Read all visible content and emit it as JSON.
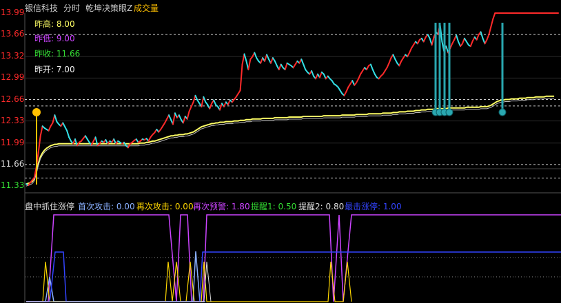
{
  "header": {
    "stock_name": "银信科技",
    "mode": "分时",
    "indicator": "乾坤决策眼Z",
    "volume_tab": "成交量"
  },
  "colors": {
    "up": "#ff2a2a",
    "down": "#33e0e6",
    "avg": "#ffff66",
    "gold": "#ffc000",
    "limit_marker": "#2aa7b0",
    "first_attack": "#8ab0ff",
    "second_attack": "#ffd700",
    "second_warning": "#cc44ff",
    "remind1": "#33dd33",
    "remind2": "#dddddd",
    "break_limit": "#3344ff"
  },
  "info": {
    "prev_high": "昨高: 8.00",
    "prev_low": "昨低: 9.00",
    "prev_close": "昨收: 11.66",
    "prev_open": "昨开: 7.00"
  },
  "indicator_panel": {
    "title": "盘中抓住涨停",
    "first_attack": "首次攻击: 0.00",
    "second_attack": "再次攻击: 0.00",
    "second_warning": "再次预警: 1.80",
    "remind1": "提醒1: 0.50",
    "remind2": "提醒2: 0.80",
    "break_limit": "最击涨停: 1.00"
  },
  "chart_data": {
    "type": "line",
    "ylim": [
      11.33,
      13.99
    ],
    "y_ticks": [
      "13.99",
      "13.66",
      "13.32",
      "12.99",
      "12.66",
      "12.33",
      "11.99",
      "11.66",
      "11.33"
    ],
    "series": [
      {
        "values": [
          11.36,
          11.34,
          11.38,
          11.42,
          11.46,
          11.62,
          11.85,
          12.1,
          12.25,
          12.22,
          12.2,
          12.18,
          12.25,
          12.3,
          12.42,
          12.32,
          12.28,
          12.25,
          12.3,
          12.24,
          12.18,
          12.08,
          12.02,
          11.98,
          12.05,
          11.95,
          12.0,
          12.02,
          12.06,
          12.1,
          12.05,
          12.0,
          11.96,
          12.02,
          12.08,
          11.95,
          11.98,
          12.02,
          12.0,
          12.04,
          11.98,
          12.02,
          12.0,
          12.05,
          11.98,
          12.02,
          12.0,
          11.98,
          12.0,
          11.95,
          11.92,
          11.98,
          12.0,
          12.03,
          12.05,
          12.0,
          12.02,
          12.05,
          12.04,
          12.06,
          12.02,
          12.08,
          12.12,
          12.15,
          12.2,
          12.16,
          12.2,
          12.25,
          12.3,
          12.36,
          12.42,
          12.35,
          12.28,
          12.45,
          12.38,
          12.42,
          12.35,
          12.3,
          12.4,
          12.36,
          12.48,
          12.55,
          12.62,
          12.72,
          12.65,
          12.6,
          12.55,
          12.7,
          12.62,
          12.58,
          12.52,
          12.6,
          12.65,
          12.58,
          12.55,
          12.5,
          12.6,
          12.55,
          12.62,
          12.58,
          12.65,
          12.62,
          12.66,
          12.7,
          12.75,
          12.8,
          13.2,
          13.36,
          13.25,
          13.12,
          13.28,
          13.32,
          13.38,
          13.3,
          13.25,
          13.22,
          13.3,
          13.25,
          13.35,
          13.28,
          13.22,
          13.3,
          13.25,
          13.18,
          13.12,
          13.2,
          13.15,
          13.12,
          13.22,
          13.2,
          13.18,
          13.15,
          13.2,
          13.25,
          13.22,
          13.28,
          13.2,
          13.12,
          13.08,
          13.05,
          13.1,
          13.02,
          12.98,
          13.05,
          13.0,
          13.08,
          13.05,
          12.98,
          13.02,
          12.98,
          12.95,
          12.9,
          12.88,
          12.85,
          12.8,
          12.75,
          12.72,
          12.78,
          12.85,
          12.9,
          12.95,
          12.88,
          12.92,
          12.98,
          13.05,
          13.1,
          13.15,
          13.12,
          13.18,
          13.2,
          13.12,
          13.05,
          13.0,
          12.98,
          13.02,
          13.05,
          13.1,
          13.15,
          13.22,
          13.3,
          13.35,
          13.28,
          13.22,
          13.18,
          13.25,
          13.3,
          13.35,
          13.32,
          13.38,
          13.45,
          13.5,
          13.55,
          13.52,
          13.58,
          13.6,
          13.55,
          13.62,
          13.66,
          13.6,
          13.5,
          13.62,
          13.7,
          13.66,
          13.82,
          13.55,
          13.4,
          13.48,
          13.38,
          13.45,
          13.52,
          13.58,
          13.65,
          13.55,
          13.48,
          13.52,
          13.6,
          13.55,
          13.5,
          13.48,
          13.56,
          13.62,
          13.58,
          13.66,
          13.7,
          13.6,
          13.52,
          13.58,
          13.66,
          13.78,
          13.9,
          13.99,
          13.99,
          13.99,
          13.99,
          13.99,
          13.99,
          13.99,
          13.99,
          13.99,
          13.99,
          13.99,
          13.99,
          13.99,
          13.99,
          13.99,
          13.99,
          13.99,
          13.99,
          13.99,
          13.99,
          13.99,
          13.99,
          13.99,
          13.99,
          13.99,
          13.99,
          13.99,
          13.99,
          13.99,
          13.99,
          13.99,
          13.99
        ]
      },
      {
        "values": [
          11.36,
          11.37,
          11.38,
          11.4,
          11.44,
          11.55,
          11.68,
          11.78,
          11.84,
          11.88,
          11.91,
          11.93,
          11.95,
          11.96,
          11.97,
          11.97,
          11.98,
          11.98,
          11.98,
          11.98,
          11.98,
          11.98,
          11.98,
          11.98,
          11.98,
          11.98,
          11.98,
          11.98,
          11.98,
          11.98,
          11.98,
          11.98,
          11.98,
          11.98,
          11.98,
          11.98,
          11.98,
          11.98,
          11.98,
          11.98,
          11.98,
          11.98,
          11.98,
          11.98,
          11.98,
          11.98,
          11.98,
          11.98,
          11.98,
          11.98,
          11.98,
          11.98,
          11.98,
          11.98,
          11.98,
          11.98,
          11.99,
          11.99,
          11.99,
          12.0,
          12.0,
          12.01,
          12.02,
          12.02,
          12.03,
          12.04,
          12.05,
          12.06,
          12.07,
          12.08,
          12.09,
          12.1,
          12.1,
          12.11,
          12.11,
          12.12,
          12.12,
          12.12,
          12.13,
          12.13,
          12.14,
          12.15,
          12.16,
          12.18,
          12.2,
          12.22,
          12.24,
          12.25,
          12.26,
          12.27,
          12.28,
          12.29,
          12.29,
          12.3,
          12.3,
          12.31,
          12.31,
          12.31,
          12.32,
          12.32,
          12.32,
          12.32,
          12.33,
          12.33,
          12.33,
          12.34,
          12.34,
          12.34,
          12.35,
          12.35,
          12.35,
          12.36,
          12.36,
          12.36,
          12.36,
          12.36,
          12.37,
          12.37,
          12.37,
          12.37,
          12.37,
          12.37,
          12.38,
          12.38,
          12.38,
          12.38,
          12.38,
          12.38,
          12.38,
          12.39,
          12.39,
          12.39,
          12.39,
          12.39,
          12.39,
          12.39,
          12.4,
          12.4,
          12.4,
          12.4,
          12.4,
          12.4,
          12.4,
          12.4,
          12.4,
          12.4,
          12.41,
          12.41,
          12.41,
          12.41,
          12.41,
          12.41,
          12.41,
          12.41,
          12.41,
          12.42,
          12.42,
          12.42,
          12.42,
          12.42,
          12.42,
          12.42,
          12.43,
          12.43,
          12.43,
          12.43,
          12.43,
          12.43,
          12.44,
          12.44,
          12.44,
          12.44,
          12.44,
          12.44,
          12.44,
          12.45,
          12.45,
          12.45,
          12.45,
          12.45,
          12.46,
          12.46,
          12.46,
          12.47,
          12.47,
          12.47,
          12.47,
          12.48,
          12.48,
          12.48,
          12.48,
          12.49,
          12.49,
          12.49,
          12.5,
          12.5,
          12.5,
          12.51,
          12.51,
          12.51,
          12.51,
          12.52,
          12.52,
          12.52,
          12.52,
          12.52,
          12.52,
          12.53,
          12.53,
          12.53,
          12.53,
          12.53,
          12.53,
          12.53,
          12.53,
          12.53,
          12.54,
          12.54,
          12.54,
          12.54,
          12.54,
          12.54,
          12.54,
          12.55,
          12.55,
          12.55,
          12.55,
          12.56,
          12.57,
          12.59,
          12.61,
          12.63,
          12.64,
          12.65,
          12.65,
          12.66,
          12.66,
          12.66,
          12.67,
          12.67,
          12.67,
          12.67,
          12.68,
          12.68,
          12.68,
          12.68,
          12.69,
          12.69,
          12.69,
          12.69,
          12.7,
          12.7,
          12.7,
          12.7,
          12.7,
          12.71,
          12.71,
          12.71,
          12.71,
          12.71
        ]
      }
    ]
  }
}
